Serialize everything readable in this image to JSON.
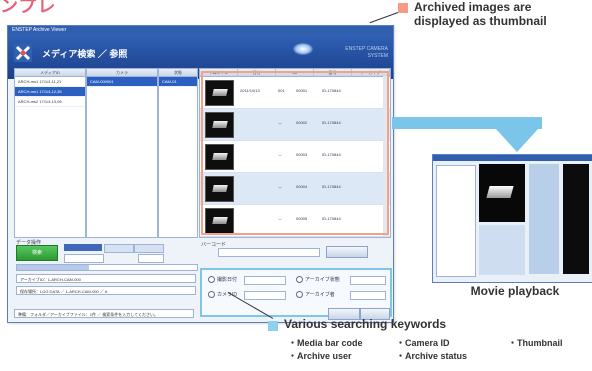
{
  "page": {
    "top_fragment": "ンプレ",
    "callout_top": {
      "line1": "Archived images are",
      "line2": "displayed as thumbnail",
      "color": "#f59a84"
    },
    "callout_bottom": {
      "title": "Various searching keywords",
      "keywords": [
        "・Media bar code",
        "・Camera ID",
        "・Thumbnail",
        "・Archive user",
        "・Archive status"
      ],
      "color": "#8dd1ee"
    },
    "movie_caption": "Movie playback",
    "arrow_color": "#7cc5ea"
  },
  "app": {
    "window_title": "ENSTEP Archive Viewer",
    "title": "メディア検索 ／ 参照",
    "brand": "ENSTEP CAMERA SYSTEM",
    "logo_icon": "x-logo-icon",
    "list1": {
      "header": "メディアID",
      "items": [
        "ARCH-ms1 17/1/4,11,21",
        "ARCH-ms1 17/1/4,12,35",
        "ARCH-ms2 17/1/4,13,06"
      ]
    },
    "list2": {
      "header": "カメラ",
      "items": [
        "CAM-000001"
      ]
    },
    "list3": {
      "header": "状態",
      "items": [
        "CAM-01"
      ]
    },
    "results": {
      "headers": [
        "サムネイル",
        "日付",
        "No",
        "番号",
        "アーカイブ"
      ],
      "rows": [
        {
          "date": "2011/10/13",
          "no": "001",
          "num": "00001",
          "id": "ID-170844"
        },
        {
          "date": "",
          "no": "—",
          "num": "00002",
          "id": "ID-170844"
        },
        {
          "date": "",
          "no": "—",
          "num": "00003",
          "id": "ID-170844"
        },
        {
          "date": "",
          "no": "—",
          "num": "00004",
          "id": "ID-170844"
        },
        {
          "date": "",
          "no": "—",
          "num": "00005",
          "id": "ID-170844"
        }
      ]
    },
    "controls": {
      "label": "データ操作",
      "green_button": "検索",
      "progress": 0.4
    },
    "info_lines": [
      "アーカイブID：1-ARCH-CAM-000",
      "保存場所：LOG DATA ／ 1-ARCH-CAM-000 ／ A"
    ],
    "right_label": "バーコード",
    "search": {
      "options": [
        "撮影日付",
        "カメラID",
        "アーカイブ状態",
        "アーカイブ者"
      ]
    },
    "status": "準備：フォルダ／アーカイブファイル：1件 ／ 検索条件を入力してください。"
  }
}
